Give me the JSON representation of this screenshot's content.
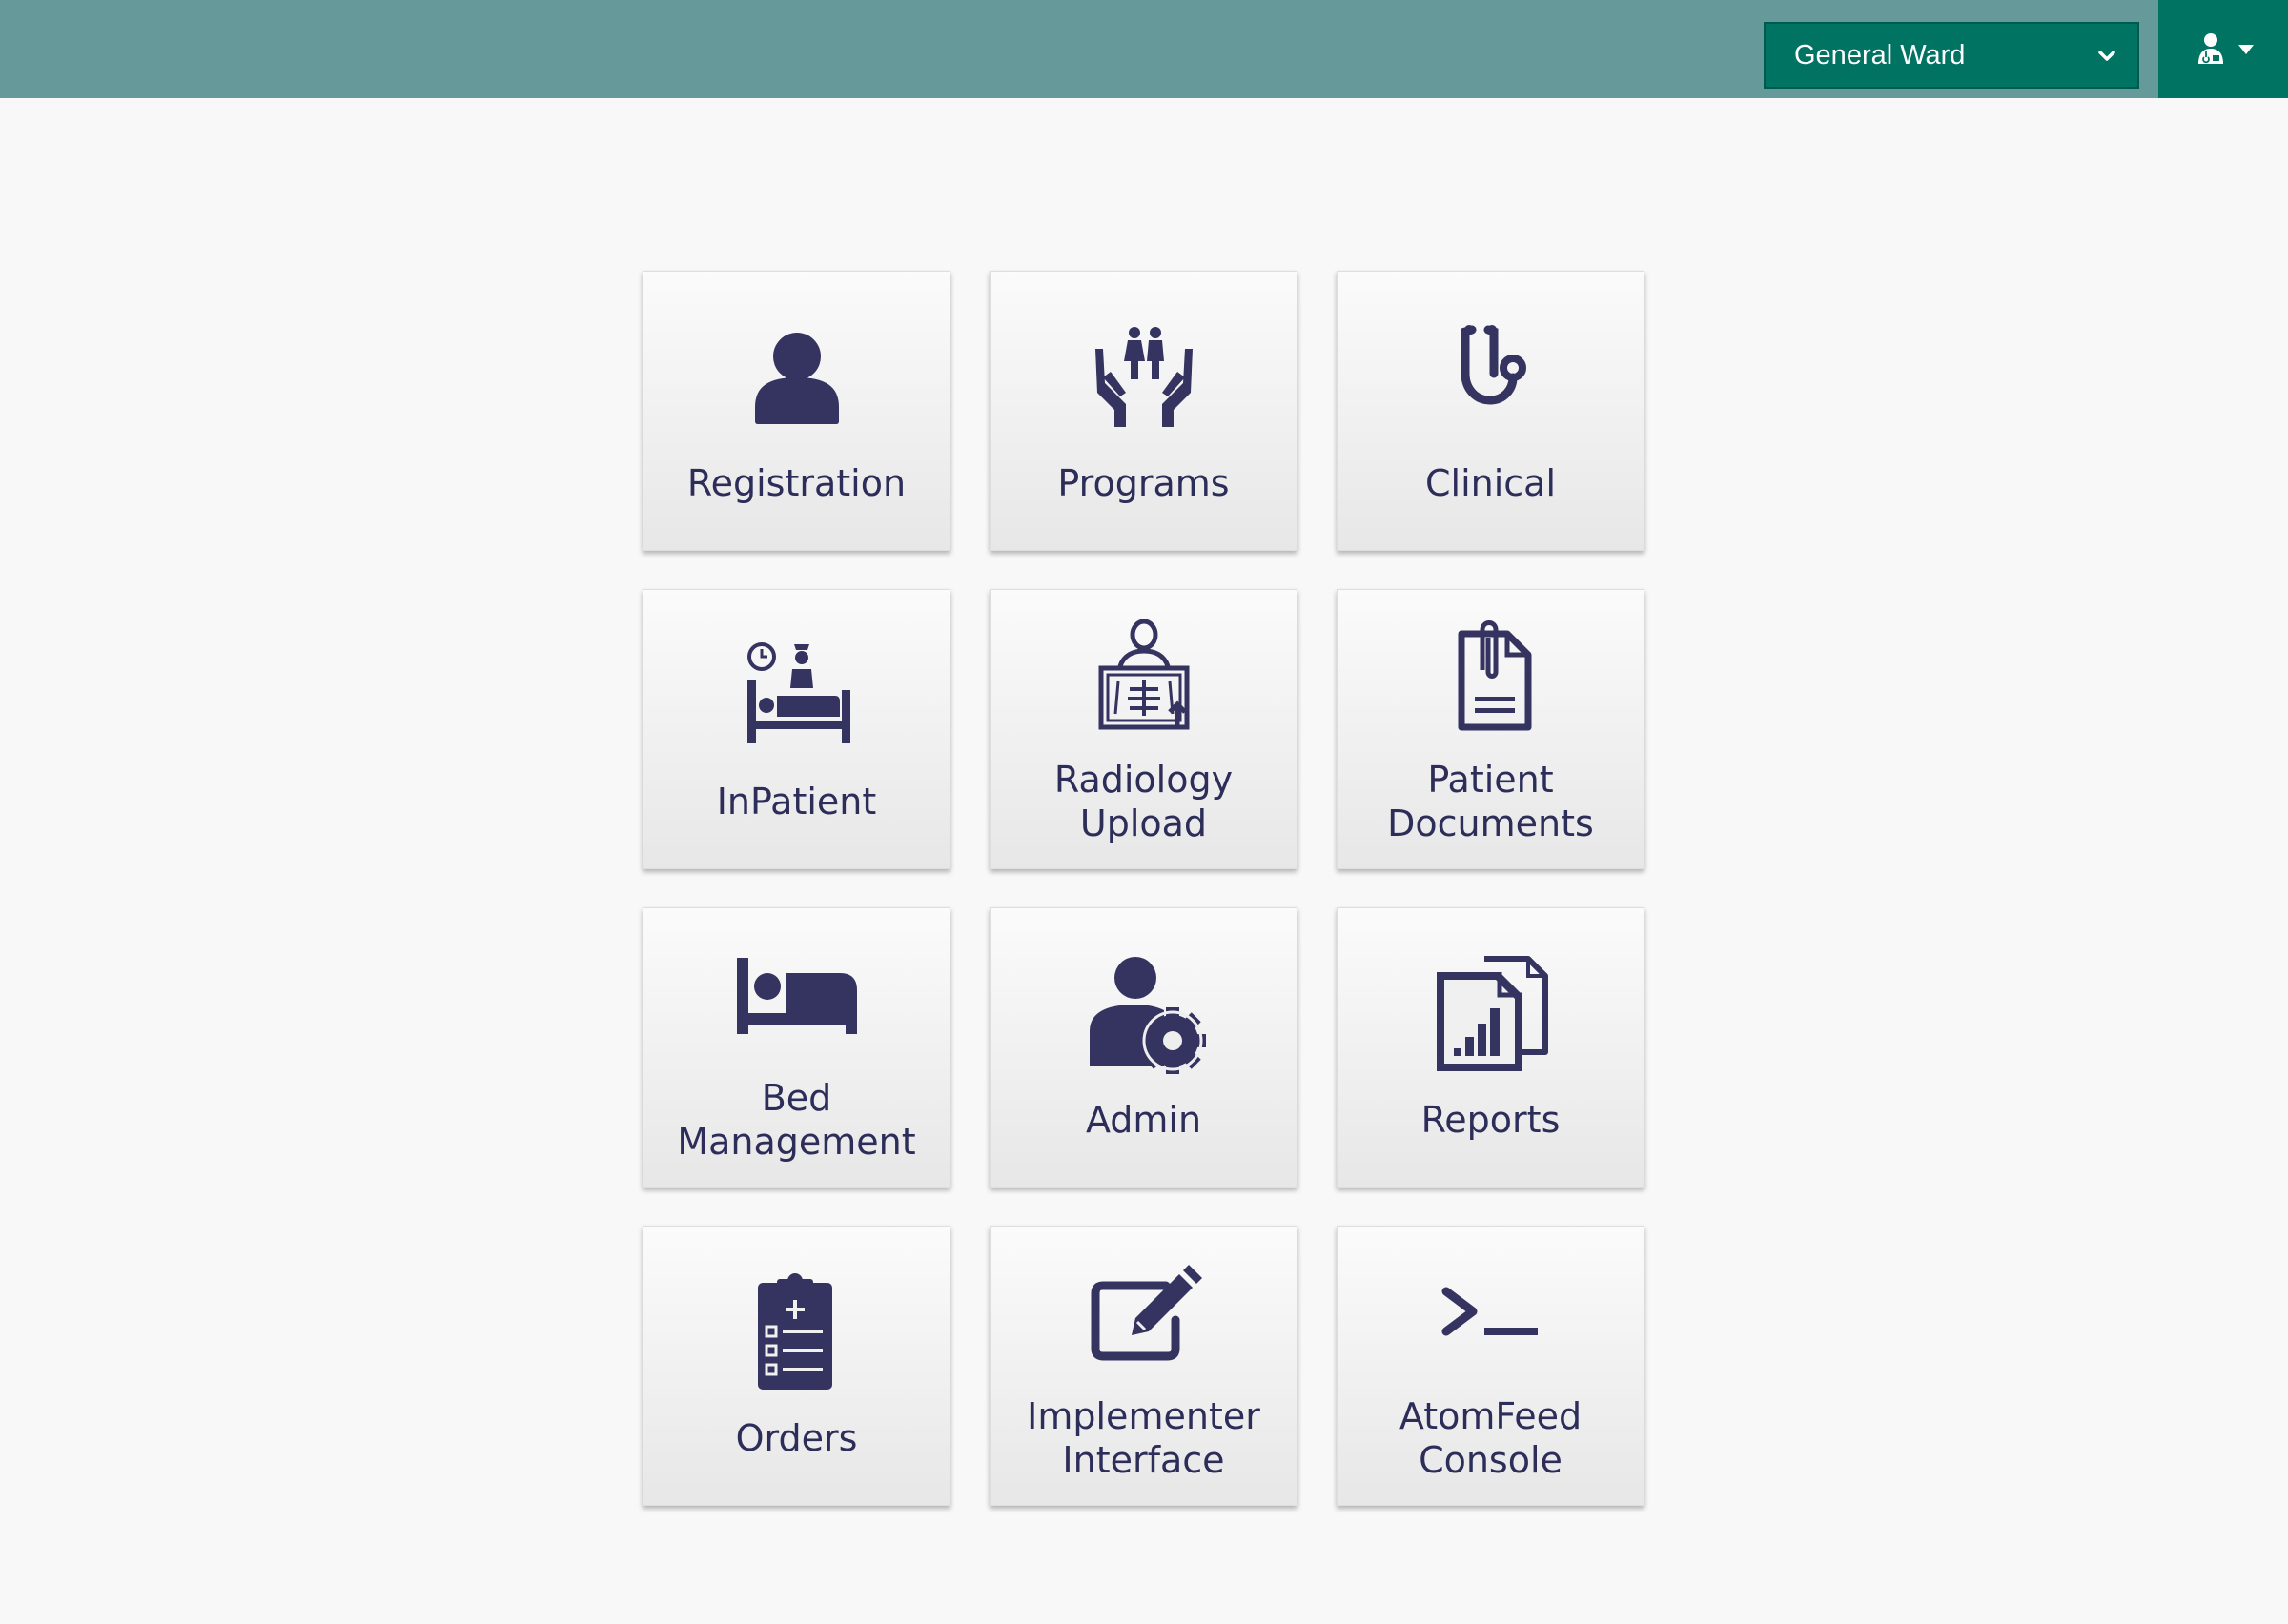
{
  "header": {
    "background_color": "#669a9a",
    "location_select": {
      "value": "General Ward",
      "icon": "chevron-down-icon",
      "background_color": "#007363"
    },
    "user_menu": {
      "icon": "user-doctor-icon",
      "caret": "caret-down-icon"
    }
  },
  "apps": [
    {
      "label": "Registration",
      "icon": "user-icon"
    },
    {
      "label": "Programs",
      "icon": "hands-family-icon"
    },
    {
      "label": "Clinical",
      "icon": "stethoscope-icon"
    },
    {
      "label": "InPatient",
      "icon": "inpatient-bed-nurse-icon"
    },
    {
      "label": "Radiology\nUpload",
      "icon": "xray-icon"
    },
    {
      "label": "Patient\nDocuments",
      "icon": "document-paperclip-icon"
    },
    {
      "label": "Bed\nManagement",
      "icon": "bed-icon"
    },
    {
      "label": "Admin",
      "icon": "user-gear-icon"
    },
    {
      "label": "Reports",
      "icon": "report-chart-icon"
    },
    {
      "label": "Orders",
      "icon": "clipboard-list-icon"
    },
    {
      "label": "Implementer\nInterface",
      "icon": "edit-icon"
    },
    {
      "label": "AtomFeed\nConsole",
      "icon": "terminal-icon"
    }
  ],
  "icon_color": "#35335f"
}
